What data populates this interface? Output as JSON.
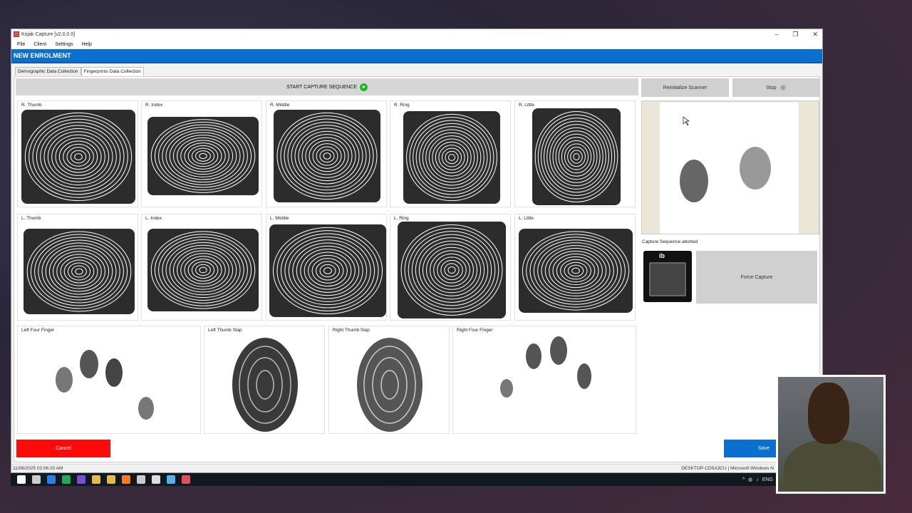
{
  "window": {
    "title": "Kojak Capture [v2.0.0.0]",
    "controls": [
      "–",
      "❐",
      "✕"
    ]
  },
  "menu": [
    "File",
    "Client",
    "Settings",
    "Help"
  ],
  "header": {
    "title": "NEW ENROLMENT"
  },
  "tabs": [
    {
      "label": "Demographic Data Collection",
      "active": false
    },
    {
      "label": "Fingerprints Data Collection",
      "active": true
    }
  ],
  "controls": {
    "start_capture": "START CAPTURE SEQUENCE",
    "reinitialize": "Reinitialize Scanner",
    "stop": "Stop",
    "force_capture": "Force Capture",
    "status": "Capture Sequence aborted",
    "scanner_logo": "ib"
  },
  "fingers": {
    "right": [
      "R. Thumb",
      "R. Index",
      "R. Middle",
      "R. Ring",
      "R. Little"
    ],
    "left": [
      "L. Thumb",
      "L. Index",
      "L. Middle",
      "L. Ring",
      "L. Little"
    ],
    "slaps": [
      "Left Four Finger",
      "Left Thumb Slap",
      "Right Thumb Slap",
      "Right Four Finger"
    ]
  },
  "footer": {
    "cancel": "Cancel",
    "save": "Save",
    "timestamp": "11/08/2025 02:06:20 AM",
    "machine": "DESKTOP-CD5A3CU | Microsoft Windows N"
  },
  "taskbar": {
    "tray_lang": "ENG",
    "icon_colors": [
      "#ffffff",
      "#cccccc",
      "#2b7de9",
      "#22aa55",
      "#7b4fd0",
      "#e8b84a",
      "#e8b84a",
      "#ff7a1a",
      "#cccccc",
      "#dddddd",
      "#58b0e8",
      "#e05060"
    ]
  }
}
